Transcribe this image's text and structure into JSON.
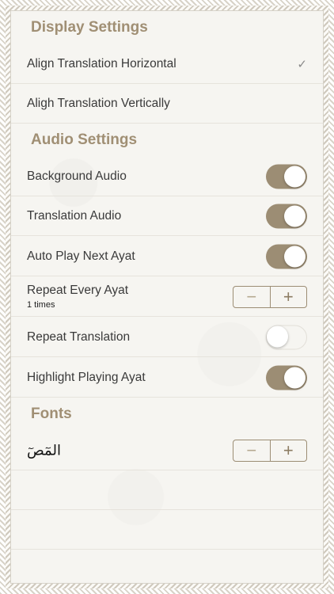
{
  "display": {
    "header": "Display Settings",
    "rows": [
      {
        "label": "Align Translation Horizontal",
        "check": "✓"
      },
      {
        "label": "Aligh Translation Vertically"
      }
    ]
  },
  "audio": {
    "header": "Audio Settings",
    "background_audio": {
      "label": "Background Audio",
      "state": "on"
    },
    "translation_audio": {
      "label": "Translation Audio",
      "state": "on"
    },
    "auto_play": {
      "label": "Auto Play Next Ayat",
      "state": "on"
    },
    "repeat_every": {
      "label": "Repeat Every Ayat",
      "sub": "1 times",
      "minus": "−",
      "plus": "+"
    },
    "repeat_translation": {
      "label": "Repeat Translation",
      "state": "off"
    },
    "highlight": {
      "label": "Highlight Playing Ayat",
      "state": "on"
    }
  },
  "fonts": {
    "header": "Fonts",
    "sample": "المٓصٓ",
    "minus": "−",
    "plus": "+"
  },
  "colors": {
    "accent": "#9c8d74",
    "header_text": "#a08f74",
    "background": "#f6f5f1"
  }
}
